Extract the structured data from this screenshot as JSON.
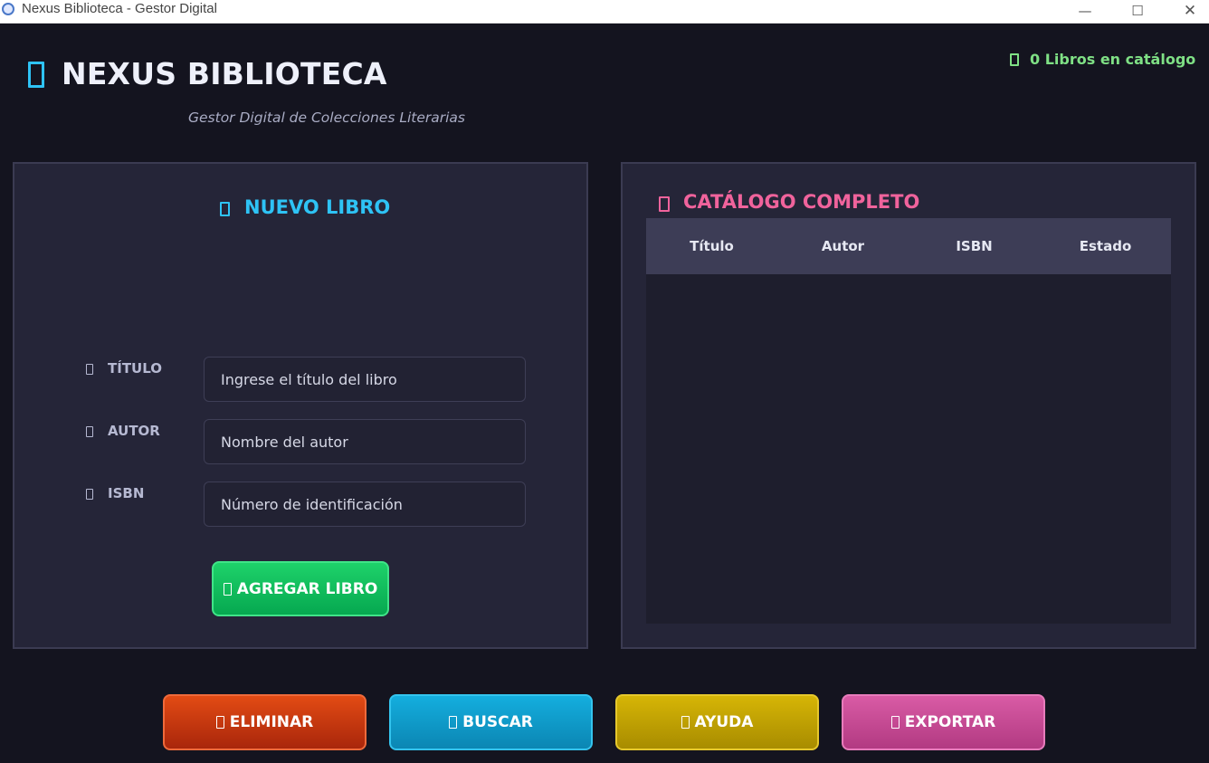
{
  "window": {
    "title": "Nexus Biblioteca - Gestor Digital",
    "minimize_glyph": "—",
    "maximize_glyph": "☐",
    "close_glyph": "✕"
  },
  "header": {
    "title": "NEXUS BIBLIOTECA",
    "subtitle": "Gestor Digital de Colecciones Literarias",
    "book_count": "0 Libros en catálogo"
  },
  "form": {
    "heading": "NUEVO LIBRO",
    "fields": [
      {
        "label": "TÍTULO",
        "placeholder": "Ingrese el título del libro",
        "icon": "title-icon"
      },
      {
        "label": "AUTOR",
        "placeholder": "Nombre del autor",
        "icon": "author-icon"
      },
      {
        "label": "ISBN",
        "placeholder": "Número de identificación",
        "icon": "isbn-icon"
      }
    ],
    "add_button": "AGREGAR LIBRO"
  },
  "catalog": {
    "heading": "CATÁLOGO COMPLETO",
    "columns": [
      "Título",
      "Autor",
      "ISBN",
      "Estado"
    ],
    "rows": []
  },
  "actions": {
    "delete": "ELIMINAR",
    "search": "BUSCAR",
    "help": "AYUDA",
    "export": "EXPORTAR"
  },
  "colors": {
    "background": "#14141f",
    "panel": "#252538",
    "accent_blue": "#2ec3f5",
    "accent_pink": "#f0639c",
    "accent_green": "#7fe085",
    "add_button": "#06a850",
    "delete_button": "#c9370f",
    "search_button": "#0f9bc9",
    "help_button": "#c4a503",
    "export_button": "#c84a94"
  }
}
